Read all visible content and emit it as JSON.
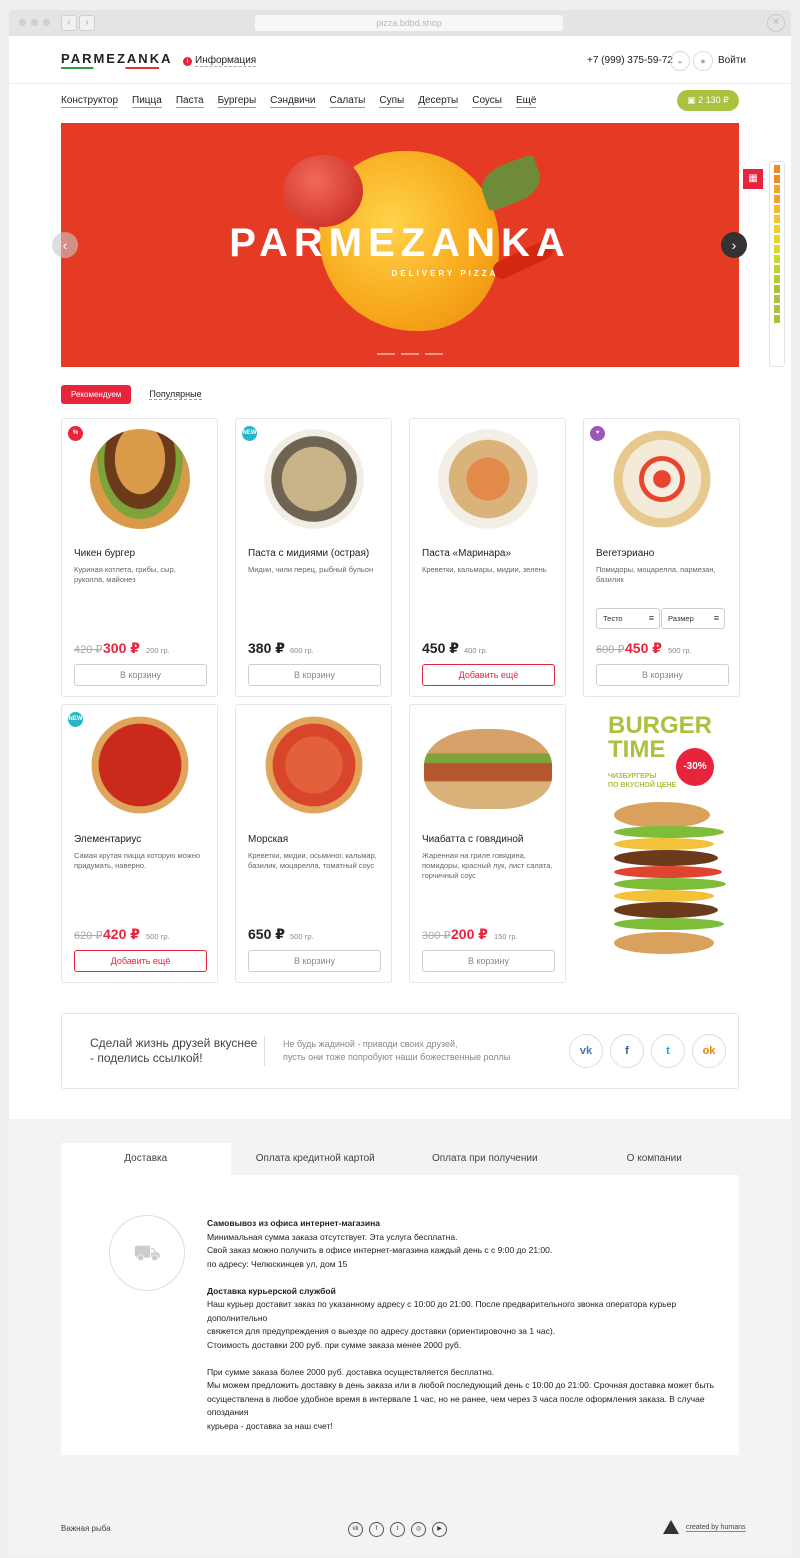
{
  "browser": {
    "url": "pizza.bdbd.shop"
  },
  "header": {
    "logo": "PARMEZANKA",
    "info_link": "Информация",
    "phone": "+7 (999) 375-59-72",
    "login": "Войти",
    "cart_total": "2 130 ₽"
  },
  "nav": [
    "Конструктор",
    "Пицца",
    "Паста",
    "Бургеры",
    "Сэндвичи",
    "Салаты",
    "Супы",
    "Десерты",
    "Соусы",
    "Ещё"
  ],
  "hero": {
    "title": "PARMEZANKA",
    "subtitle": "DELIVERY PIZZA"
  },
  "tabs": {
    "active": "Рекомендуем",
    "inactive": "Популярные"
  },
  "products": [
    {
      "badge": "%",
      "name": "Чикен бургер",
      "desc": "Куриная котлета, грибы, сыр, руколла, майонез",
      "old_price": "420 ₽",
      "price": "300 ₽",
      "weight": "200 гр.",
      "button": "В корзину"
    },
    {
      "badge": "NEW",
      "name": "Паста с мидиями (острая)",
      "desc": "Мидии, чили перец, рыбный бульон",
      "old_price": "",
      "price": "380 ₽",
      "weight": "600 гр.",
      "button": "В корзину"
    },
    {
      "badge": "",
      "name": "Паста «Маринара»",
      "desc": "Креветки, кальмары, мидии, зелень",
      "old_price": "",
      "price": "450 ₽",
      "weight": "400 гр.",
      "button": "Добавить ещё"
    },
    {
      "badge": "♥",
      "name": "Вегетэриано",
      "desc": "Помидоры, моцарелла, пармезан, базилик",
      "old_price": "600 ₽",
      "price": "450 ₽",
      "weight": "500 гр.",
      "button": "В корзину",
      "select_dough": "Тесто",
      "select_size": "Размер"
    },
    {
      "badge": "NEW",
      "name": "Элементариус",
      "desc": "Самая крутая пицца которую можно придумать, наверно.",
      "old_price": "620 ₽",
      "price": "420 ₽",
      "weight": "500 гр.",
      "button": "Добавить ещё"
    },
    {
      "badge": "",
      "name": "Морская",
      "desc": "Креветки, мидии, осьминог, кальмар, базилик, моцарелла, томатный соус",
      "old_price": "",
      "price": "650 ₽",
      "weight": "500 гр.",
      "button": "В корзину"
    },
    {
      "badge": "",
      "name": "Чиабатта с говядиной",
      "desc": "Жаренная на гриле говядина, помидоры, красный лук, лист салата, горчичный соус",
      "old_price": "300 ₽",
      "price": "200 ₽",
      "weight": "150 гр.",
      "button": "В корзину"
    }
  ],
  "promo": {
    "title1": "BURGER",
    "title2": "TIME",
    "discount": "-30%",
    "line1": "ЧИЗБУРГЕРЫ",
    "line2": "ПО ВКУСНОЙ ЦЕНЕ"
  },
  "share": {
    "heading": "Сделай жизнь друзей вкуснее - поделись ссылкой!",
    "text1": "Не будь жадиной - приводи своих друзей,",
    "text2": "пусть они тоже попробуют наши божественные роллы"
  },
  "footer_tabs": [
    "Доставка",
    "Оплата кредитной картой",
    "Оплата при получении",
    "О компании"
  ],
  "delivery": {
    "h1": "Самовывоз из офиса интернет-магазина",
    "p1a": "Минимальная сумма заказа отсутствует. Эта услуга бесплатна.",
    "p1b": "Свой заказ можно получить в офисе интернет-магазина каждый день с с 9:00 до 21:00.",
    "p1c": "по адресу: Челюскинцев ул, дом 15",
    "h2": "Доставка курьерской службой",
    "p2a": "Наш курьер доставит заказ по указанному адресу с 10:00 до 21:00. После предварительного звонка оператора курьер дополнительно",
    "p2b": "свяжется для предупреждения о выезде по адресу доставки (ориентировочно за 1 час).",
    "p2c": "Стоимость доставки 200 руб. при сумме заказа менее 2000 руб.",
    "p3a": "При сумме заказа более 2000 руб. доставка осуществляется бесплатно.",
    "p3b": "Мы можем предложить доставку в день заказа или в любой последующий день с 10:00 до 21:00. Срочная доставка может быть",
    "p3c": "осуществлена в любое удобное время в интервале 1 час, но не ранее, чем через 3 часа после оформления заказа. В случае опоздания",
    "p3d": "курьера - доставка за наш счет!"
  },
  "footer": {
    "copyright": "Важная рыба",
    "made_by": "created by humans"
  },
  "colors": {
    "accent": "#e8233c",
    "green": "#a9c23f",
    "hero": "#e53b25"
  }
}
